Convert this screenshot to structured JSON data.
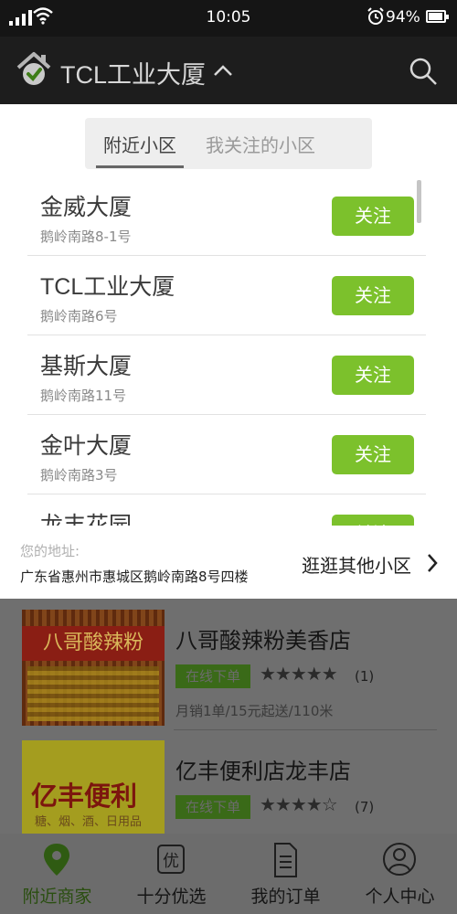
{
  "status_bar": {
    "time": "10:05",
    "battery": "94%",
    "battery_level": 0.94,
    "icons": [
      "signal-icon",
      "wifi-icon",
      "alarm-icon",
      "battery-icon"
    ]
  },
  "header": {
    "title": "TCL工业大厦",
    "icons": [
      "home-logo-icon",
      "caret-up-icon",
      "search-icon"
    ]
  },
  "tabs": [
    {
      "label": "附近小区",
      "active": true
    },
    {
      "label": "我关注的小区",
      "active": false
    }
  ],
  "communities": [
    {
      "name": "金威大厦",
      "address": "鹅岭南路8-1号",
      "button": "关注"
    },
    {
      "name": "TCL工业大厦",
      "address": "鹅岭南路6号",
      "button": "关注"
    },
    {
      "name": "基斯大厦",
      "address": "鹅岭南路11号",
      "button": "关注"
    },
    {
      "name": "金叶大厦",
      "address": "鹅岭南路3号",
      "button": "关注"
    },
    {
      "name": "龙丰花园",
      "address": "",
      "button": "关注"
    }
  ],
  "address": {
    "label": "您的地址:",
    "value": "广东省惠州市惠城区鹅岭南路8号四楼",
    "browse_label": "逛逛其他小区"
  },
  "shops": [
    {
      "name": "八哥酸辣粉美香店",
      "badge": "在线下单",
      "rating": 5,
      "stars": "★★★★★",
      "count": "(1)",
      "meta": "月销1单/15元起送/110米",
      "image_sign": "八哥酸辣粉"
    },
    {
      "name": "亿丰便利店龙丰店",
      "badge": "在线下单",
      "rating": 4.5,
      "stars": "★★★★☆",
      "count": "(7)",
      "meta": "",
      "image_sign": "亿丰便利",
      "image_sub": "糖、烟、酒、日用品"
    }
  ],
  "bottom_nav": [
    {
      "label": "附近商家",
      "icon": "location-pin-icon",
      "active": true
    },
    {
      "label": "十分优选",
      "icon": "youxuan-icon",
      "active": false
    },
    {
      "label": "我的订单",
      "icon": "document-icon",
      "active": false
    },
    {
      "label": "个人中心",
      "icon": "person-icon",
      "active": false
    }
  ],
  "colors": {
    "accent_green": "#7cc12c",
    "header_bg": "#1d1d1d",
    "overlay": "#6f6f6f"
  }
}
